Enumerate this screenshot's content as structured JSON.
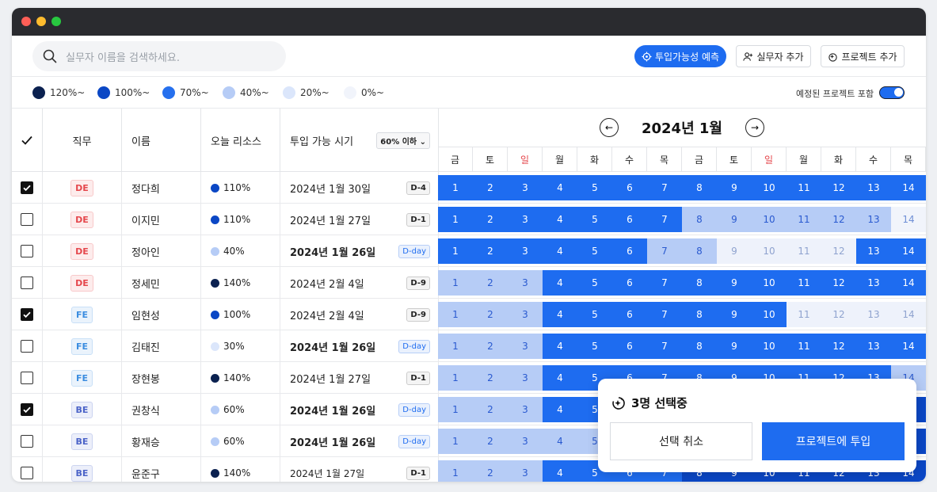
{
  "search": {
    "placeholder": "실무자 이름을 검색하세요."
  },
  "toolbar": {
    "predict_label": "투입가능성 예측",
    "add_worker_label": "실무자 추가",
    "add_project_label": "프로젝트 추가"
  },
  "legend": [
    {
      "label": "120%~",
      "color": "#0b2150"
    },
    {
      "label": "100%~",
      "color": "#0b47c5"
    },
    {
      "label": "70%~",
      "color": "#2670ee"
    },
    {
      "label": "40%~",
      "color": "#b6ccf6"
    },
    {
      "label": "20%~",
      "color": "#dbe6fb"
    },
    {
      "label": "0%~",
      "color": "#f1f4fb"
    }
  ],
  "toggle": {
    "label": "예정된 프로젝트 포함",
    "on": true
  },
  "headers": {
    "check": "✓",
    "role": "직무",
    "name": "이름",
    "risk": "오늘 리소스",
    "avail": "투입 가능 시기",
    "filter": "60% 이하"
  },
  "calendar": {
    "month": "2024년 1월",
    "weekdays": [
      "금",
      "토",
      "일",
      "월",
      "화",
      "수",
      "목",
      "금",
      "토",
      "일",
      "월",
      "화",
      "수",
      "목"
    ]
  },
  "rows": [
    {
      "checked": true,
      "role": "DE",
      "name": "정다희",
      "risk": "110%",
      "risk_color": "#0b47c5",
      "date": "2024년 1월 30일",
      "bold": false,
      "dday": "D-4",
      "levels": [
        3,
        3,
        3,
        3,
        3,
        3,
        3,
        3,
        3,
        3,
        3,
        3,
        3,
        3
      ]
    },
    {
      "checked": false,
      "role": "DE",
      "name": "이지민",
      "risk": "110%",
      "risk_color": "#0b47c5",
      "date": "2024년 1월 27일",
      "bold": false,
      "dday": "D-1",
      "levels": [
        3,
        3,
        3,
        3,
        3,
        3,
        3,
        2,
        2,
        2,
        2,
        2,
        2,
        0
      ]
    },
    {
      "checked": false,
      "role": "DE",
      "name": "정아인",
      "risk": "40%",
      "risk_color": "#b6ccf6",
      "date": "2024년 1월 26일",
      "bold": true,
      "dday": "D-day",
      "levels": [
        3,
        3,
        3,
        3,
        3,
        3,
        2,
        2,
        1,
        1,
        1,
        1,
        3,
        3
      ]
    },
    {
      "checked": false,
      "role": "DE",
      "name": "정세민",
      "risk": "140%",
      "risk_color": "#0b2150",
      "date": "2024년 2월 4일",
      "bold": false,
      "dday": "D-9",
      "levels": [
        2,
        2,
        2,
        3,
        3,
        3,
        3,
        3,
        3,
        3,
        3,
        3,
        3,
        3
      ]
    },
    {
      "checked": true,
      "role": "FE",
      "name": "임현성",
      "risk": "100%",
      "risk_color": "#0b47c5",
      "date": "2024년 2월 4일",
      "bold": false,
      "dday": "D-9",
      "levels": [
        2,
        2,
        2,
        3,
        3,
        3,
        3,
        3,
        3,
        3,
        1,
        1,
        1,
        1
      ]
    },
    {
      "checked": false,
      "role": "FE",
      "name": "김태진",
      "risk": "30%",
      "risk_color": "#dbe6fb",
      "date": "2024년 1월 26일",
      "bold": true,
      "dday": "D-day",
      "levels": [
        2,
        2,
        2,
        3,
        3,
        3,
        3,
        3,
        3,
        3,
        3,
        3,
        3,
        3
      ]
    },
    {
      "checked": false,
      "role": "FE",
      "name": "장현봉",
      "risk": "140%",
      "risk_color": "#0b2150",
      "date": "2024년 1월 27일",
      "bold": false,
      "dday": "D-1",
      "levels": [
        2,
        2,
        2,
        3,
        3,
        3,
        3,
        3,
        3,
        3,
        3,
        3,
        3,
        2
      ]
    },
    {
      "checked": true,
      "role": "BE",
      "name": "권창식",
      "risk": "60%",
      "risk_color": "#b6ccf6",
      "date": "2024년 1월 26일",
      "bold": true,
      "dday": "D-day",
      "levels": [
        2,
        2,
        2,
        3,
        3,
        3,
        3,
        3,
        3,
        3,
        3,
        3,
        3,
        4
      ]
    },
    {
      "checked": false,
      "role": "BE",
      "name": "황재승",
      "risk": "60%",
      "risk_color": "#b6ccf6",
      "date": "2024년 1월 26일",
      "bold": true,
      "dday": "D-day",
      "levels": [
        2,
        2,
        2,
        2,
        2,
        2,
        2,
        2,
        2,
        2,
        2,
        2,
        2,
        4
      ]
    },
    {
      "checked": false,
      "role": "BE",
      "name": "윤준구",
      "risk": "140%",
      "risk_color": "#0b2150",
      "date": "2024년 1월 27일",
      "bold": false,
      "dday": "D-1",
      "levels": [
        2,
        2,
        2,
        3,
        3,
        3,
        3,
        4,
        4,
        4,
        4,
        4,
        4,
        4
      ]
    }
  ],
  "day_numbers": [
    "1",
    "2",
    "3",
    "4",
    "5",
    "6",
    "7",
    "8",
    "9",
    "10",
    "11",
    "12",
    "13",
    "14"
  ],
  "popup": {
    "title": "3명 선택중",
    "cancel_label": "선택 취소",
    "deploy_label": "프로젝트에 투입"
  }
}
